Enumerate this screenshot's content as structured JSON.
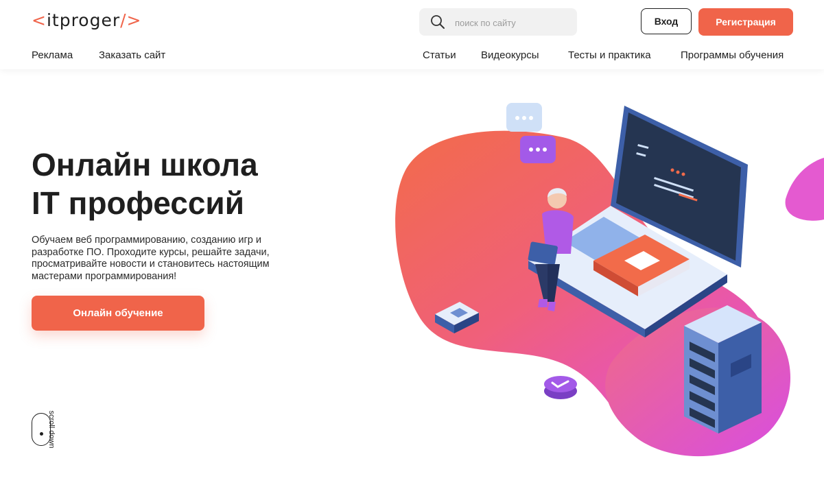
{
  "header": {
    "logo": {
      "open": "<",
      "name": "itproger",
      "close": "/>"
    },
    "search": {
      "placeholder": "поиск по сайту",
      "value": ""
    },
    "login_label": "Вход",
    "register_label": "Регистрация"
  },
  "nav": {
    "left": [
      {
        "label": "Реклама"
      },
      {
        "label": "Заказать сайт"
      }
    ],
    "right": [
      {
        "label": "Статьи"
      },
      {
        "label": "Видеокурсы"
      },
      {
        "label": "Тесты и практика"
      },
      {
        "label": "Программы обучения"
      }
    ]
  },
  "hero": {
    "title_line1": "Онлайн школа",
    "title_line2": "IT профессий",
    "text": "Обучаем веб программированию, созданию игр и разработке ПО. Проходите курсы, решайте задачи, просматривайте новости и становитесь настоящим мастерами программирования!",
    "cta_label": "Онлайн обучение"
  },
  "scroll": {
    "label": "scroll down"
  },
  "colors": {
    "accent": "#f0644a",
    "text": "#1f1f1f",
    "search_bg": "#f1f1f1",
    "blob_pink": "#e84fd0",
    "blob_orange": "#f26b4a"
  },
  "icons": {
    "search": "search-icon",
    "scroll": "mouse-icon"
  }
}
